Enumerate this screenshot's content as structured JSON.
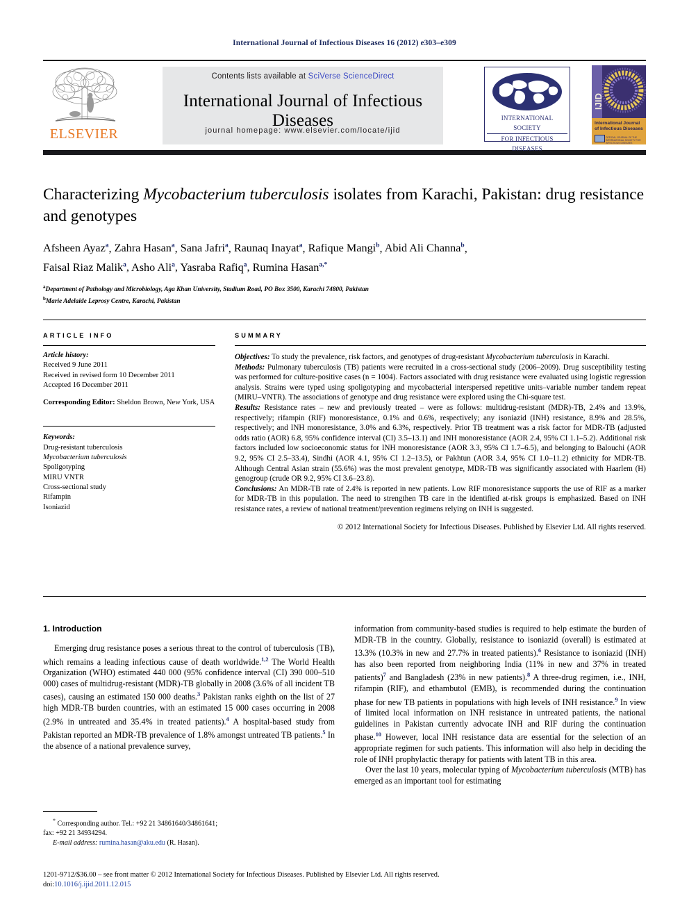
{
  "running_head": "International Journal of Infectious Diseases 16 (2012) e303–e309",
  "masthead": {
    "contents_prefix": "Contents lists available at ",
    "contents_link": "SciVerse ScienceDirect",
    "journal_title": "International Journal of Infectious Diseases",
    "homepage": "journal homepage: www.elsevier.com/locate/ijid",
    "elsevier_wordmark": "ELSEVIER",
    "isid_line1": "INTERNATIONAL SOCIETY",
    "isid_line2": "FOR INFECTIOUS DISEASES",
    "cover_spine": "IJID",
    "cover_title_line1": "International Journal",
    "cover_title_line2": "of Infectious Diseases",
    "cover_footer": "OFFICIAL JOURNAL OF THE INTERNATIONAL SOCIETY FOR INFECTIOUS DISEASES"
  },
  "article": {
    "title_part1": "Characterizing ",
    "title_italic": "Mycobacterium tuberculosis",
    "title_part2": " isolates from Karachi, Pakistan: drug resistance and genotypes",
    "authors": [
      {
        "name": "Afsheen Ayaz",
        "sup": "a"
      },
      {
        "name": "Zahra Hasan",
        "sup": "a"
      },
      {
        "name": "Sana Jafri",
        "sup": "a"
      },
      {
        "name": "Raunaq Inayat",
        "sup": "a"
      },
      {
        "name": "Rafique Mangi",
        "sup": "b"
      },
      {
        "name": "Abid Ali Channa",
        "sup": "b"
      },
      {
        "name": "Faisal Riaz Malik",
        "sup": "a"
      },
      {
        "name": "Asho Ali",
        "sup": "a"
      },
      {
        "name": "Yasraba Rafiq",
        "sup": "a"
      },
      {
        "name": "Rumina Hasan",
        "sup": "a,*"
      }
    ],
    "affiliation_a_sup": "a",
    "affiliation_a": "Department of Pathology and Microbiology, Aga Khan University, Stadium Road, PO Box 3500, Karachi 74800, Pakistan",
    "affiliation_b_sup": "b",
    "affiliation_b": "Marie Adelaide Leprosy Centre, Karachi, Pakistan"
  },
  "article_info": {
    "heading": "ARTICLE INFO",
    "history_label": "Article history:",
    "history": [
      "Received 9 June 2011",
      "Received in revised form 10 December 2011",
      "Accepted 16 December 2011"
    ],
    "corresponding_editor_label": "Corresponding Editor:",
    "corresponding_editor_value": " Sheldon Brown, New York, USA",
    "keywords_label": "Keywords:",
    "keywords": [
      "Drug-resistant tuberculosis",
      "Mycobacterium tuberculosis",
      "Spoligotyping",
      "MIRU VNTR",
      "Cross-sectional study",
      "Rifampin",
      "Isoniazid"
    ],
    "keyword_italic_index": 1
  },
  "summary": {
    "heading": "SUMMARY",
    "objectives_label": "Objectives:",
    "objectives_text_1": " To study the prevalence, risk factors, and genotypes of drug-resistant ",
    "objectives_italic": "Mycobacterium tuberculosis",
    "objectives_text_2": " in Karachi.",
    "methods_label": "Methods:",
    "methods_text": " Pulmonary tuberculosis (TB) patients were recruited in a cross-sectional study (2006–2009). Drug susceptibility testing was performed for culture-positive cases (n = 1004). Factors associated with drug resistance were evaluated using logistic regression analysis. Strains were typed using spoligotyping and mycobacterial interspersed repetitive units–variable number tandem repeat (MIRU–VNTR). The associations of genotype and drug resistance were explored using the Chi-square test.",
    "results_label": "Results:",
    "results_text": " Resistance rates – new and previously treated – were as follows: multidrug-resistant (MDR)-TB, 2.4% and 13.9%, respectively; rifampin (RIF) monoresistance, 0.1% and 0.6%, respectively; any isoniazid (INH) resistance, 8.9% and 28.5%, respectively; and INH monoresistance, 3.0% and 6.3%, respectively. Prior TB treatment was a risk factor for MDR-TB (adjusted odds ratio (AOR) 6.8, 95% confidence interval (CI) 3.5–13.1) and INH monoresistance (AOR 2.4, 95% CI 1.1–5.2). Additional risk factors included low socioeconomic status for INH monoresistance (AOR 3.3, 95% CI 1.7–6.5), and belonging to Balouchi (AOR 9.2, 95% CI 2.5–33.4), Sindhi (AOR 4.1, 95% CI 1.2–13.5), or Pakhtun (AOR 3.4, 95% CI 1.0–11.2) ethnicity for MDR-TB. Although Central Asian strain (55.6%) was the most prevalent genotype, MDR-TB was significantly associated with Haarlem (H) genogroup (crude OR 9.2, 95% CI 3.6–23.8).",
    "conclusions_label": "Conclusions:",
    "conclusions_text": " An MDR-TB rate of 2.4% is reported in new patients. Low RIF monoresistance supports the use of RIF as a marker for MDR-TB in this population. The need to strengthen TB care in the identified at-risk groups is emphasized. Based on INH resistance rates, a review of national treatment/prevention regimens relying on INH is suggested.",
    "copyright": "© 2012 International Society for Infectious Diseases. Published by Elsevier Ltd. All rights reserved."
  },
  "body": {
    "section_heading": "1. Introduction",
    "left_paragraph_1_a": "Emerging drug resistance poses a serious threat to the control of tuberculosis (TB), which remains a leading infectious cause of death worldwide.",
    "left_sup_1": "1,2",
    "left_paragraph_1_b": " The World Health Organization (WHO) estimated 440 000 (95% confidence interval (CI) 390 000–510 000) cases of multidrug-resistant (MDR)-TB globally in 2008 (3.6% of all incident TB cases), causing an estimated 150 000 deaths.",
    "left_sup_2": "3",
    "left_paragraph_1_c": " Pakistan ranks eighth on the list of 27 high MDR-TB burden countries, with an estimated 15 000 cases occurring in 2008 (2.9% in untreated and 35.4% in treated patients).",
    "left_sup_3": "4",
    "left_paragraph_1_d": " A hospital-based study from Pakistan reported an MDR-TB prevalence of 1.8% amongst untreated TB patients.",
    "left_sup_4": "5",
    "left_paragraph_1_e": " In the absence of a national prevalence survey,",
    "right_paragraph_1_a": "information from community-based studies is required to help estimate the burden of MDR-TB in the country. Globally, resistance to isoniazid (overall) is estimated at 13.3% (10.3% in new and 27.7% in treated patients).",
    "right_sup_1": "6",
    "right_paragraph_1_b": " Resistance to isoniazid (INH) has also been reported from neighboring India (11% in new and 37% in treated patients)",
    "right_sup_2": "7",
    "right_paragraph_1_c": " and Bangladesh (23% in new patients).",
    "right_sup_3": "8",
    "right_paragraph_1_d": " A three-drug regimen, i.e., INH, rifampin (RIF), and ethambutol (EMB), is recommended during the continuation phase for new TB patients in populations with high levels of INH resistance.",
    "right_sup_4": "9",
    "right_paragraph_1_e": " In view of limited local information on INH resistance in untreated patients, the national guidelines in Pakistan currently advocate INH and RIF during the continuation phase.",
    "right_sup_5": "10",
    "right_paragraph_1_f": " However, local INH resistance data are essential for the selection of an appropriate regimen for such patients. This information will also help in deciding the role of INH prophylactic therapy for patients with latent TB in this area.",
    "right_paragraph_2_a": "Over the last 10 years, molecular typing of ",
    "right_paragraph_2_italic": "Mycobacterium tuberculosis",
    "right_paragraph_2_b": " (MTB) has emerged as an important tool for estimating"
  },
  "footnote": {
    "star": "*",
    "corresponding_text": " Corresponding author. Tel.: +92 21 34861640/34861641;",
    "fax_text": "fax: +92 21 34934294.",
    "email_label": "E-mail address:",
    "email_value": " rumina.hasan@aku.edu",
    "email_suffix": " (R. Hasan)."
  },
  "bottom_matter": {
    "front_matter": "1201-9712/$36.00 – see front matter © 2012 International Society for Infectious Diseases. Published by Elsevier Ltd. All rights reserved.",
    "doi_label": "doi:",
    "doi_value": "10.1016/j.ijid.2011.12.015"
  },
  "colors": {
    "elsevier_orange": "#e87722",
    "link_blue": "#3b49c4",
    "navy": "#1c2a5e",
    "banner_gray": "#e6e7e8"
  }
}
